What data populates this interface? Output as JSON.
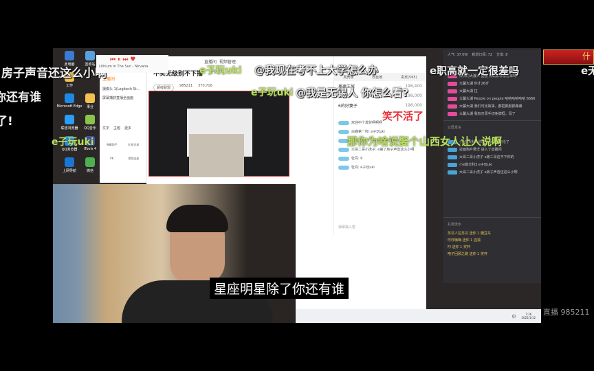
{
  "desktop_icons": [
    "此电脑",
    "回收站",
    "工作",
    "Microsoft Edge",
    "事业",
    "联想浏览器",
    "QQ音乐",
    "QQ浏览器",
    "iTools 4",
    "上网导航",
    "微信"
  ],
  "music_player": {
    "track": "Lithium In The Sun",
    "artist": "Nirvana"
  },
  "left_panel": {
    "tab": "主播间",
    "items": [
      "摄像头 1(Logitech St...",
      "屏幕捕获直播全画面"
    ],
    "tools": [
      "文字",
      "主题",
      "更多"
    ],
    "bottom": [
      "弹幕助手",
      "礼物记录",
      "PK",
      "视频连麦"
    ]
  },
  "stream_window": {
    "title": "不买无级别不下播",
    "edit": "编辑",
    "tag": "超级联盟",
    "room": "985211",
    "fans": "370,716",
    "buttons": [
      "直播间",
      "视频管理"
    ]
  },
  "ranking": {
    "tabs": [
      "周贡榜",
      "粉丝榜",
      "贵宾(565)"
    ],
    "rows": [
      {
        "name": "奥德王屎",
        "value": "198,400"
      },
      {
        "name": "和你",
        "value": "198,000"
      },
      {
        "name": "6的好妻子",
        "value": "198,000"
      }
    ]
  },
  "center_chat": [
    "欢迎中个发财啊啊啊",
    "白鹿第一抑: e子玩uki",
    "小e旋犬科3: 你好久没放周杰伦了",
    "大哥二哥小虎子: e第了房子声音这么小啊",
    "牡丹: 6",
    "牡丹: e子玩uki"
  ],
  "center_chat_input_hint": "弹幕输入框",
  "right_panel": {
    "popularity": "人气: 37.0W",
    "new_follow": "新增订阅: 72",
    "share": "分享: 8",
    "section": "公屏发言",
    "gifts_section": "礼物流水",
    "lines": [
      "懒鸭的大渡人 图图 我跟去你家过年吗",
      "大馨大湖 你才26岁",
      "大馨大湖 拉",
      "大馨大湖 People on people 哈哈哈哈哈哈 6666",
      "大馨大湖 我们可比故事。都把颜颜颜蒂蒂",
      "大馨大湖 我有刃周手切免牌框。母了"
    ],
    "chat": [
      "小e旋犬科3 你好久没放周杰伦了",
      "拉面狗片吴洋 进入了直播间",
      "大哥二哥小虎子 e第二哥这不下你的",
      "小e旋犬科3 e子玩uki",
      "大哥二哥小虎子 e房子声音还这么小啊"
    ],
    "gifts": [
      "苏坑人拉苏坑 送你 1 糖豆车",
      "呼呼嗨嗨 送你 1 血狐",
      "叼 送你 1 奖杯",
      "咆子回顾之路 送你 1 奖杯"
    ]
  },
  "taskbar": {
    "ime": "中",
    "time": "7:36",
    "date": "2022/1/12"
  },
  "subtitle": "星座明星除了你还有谁",
  "watermark": "直播 985211",
  "danmaku": {
    "d1": "房子声音还这么小啊",
    "d2": "你还有谁",
    "d3": "了!",
    "d4": "e子玩uki",
    "d5": "@我现在考不上大学怎么办",
    "d6": "e职高就一定很差吗",
    "d7": "e子玩uki",
    "d8": "@我是无锡人 你怎么看?",
    "d9": "那你为啥说娶个山西女人让人说啊",
    "d10": "e子玩uki",
    "d11": "e无",
    "sticker": "笑不活了",
    "banner": "什"
  },
  "colors": {
    "accent": "#ff7a00",
    "danmaku_green": "#b8e05a",
    "chat_panel": "#2f2f33"
  }
}
